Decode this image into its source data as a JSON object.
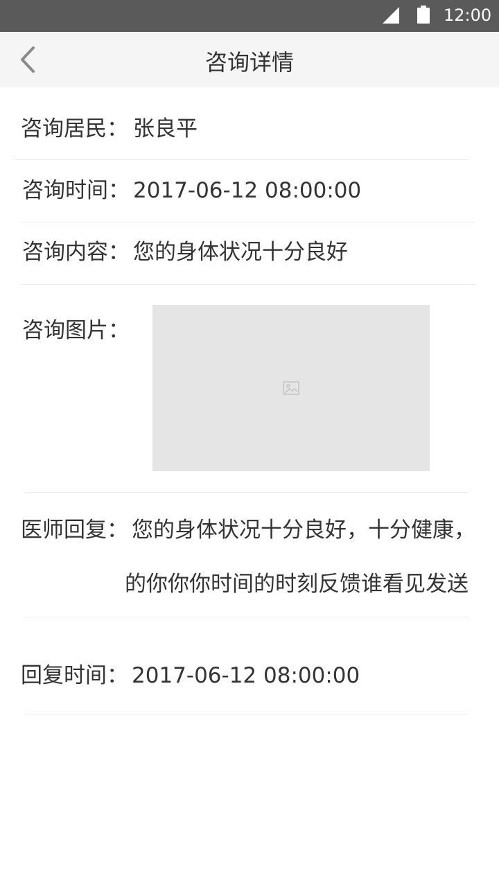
{
  "status_bar": {
    "time": "12:00",
    "icons": [
      "signal-icon",
      "battery-icon"
    ]
  },
  "header": {
    "back_icon": "chevron-left-icon",
    "title": "咨询详情"
  },
  "details": {
    "resident_label": "咨询居民：",
    "resident_value": "张良平",
    "time_label": "咨询时间：",
    "time_value": "2017-06-12 08:00:00",
    "content_label": "咨询内容：",
    "content_value": "您的身体状况十分良好",
    "image_label": "咨询图片：",
    "image_icon": "image-placeholder-icon",
    "reply_label": "医师回复：",
    "reply_line1": "您的身体状况十分良好，十分健康，",
    "reply_line2": "的你你你时间的时刻反馈谁看见发送",
    "reply_time_label": "回复时间：",
    "reply_time_value": "2017-06-12 08:00:00"
  },
  "colors": {
    "status_bar": "#5a5a5a",
    "title_bar": "#f5f5f5",
    "text": "#333333",
    "divider": "#ececec",
    "image_placeholder": "#e5e5e5"
  }
}
